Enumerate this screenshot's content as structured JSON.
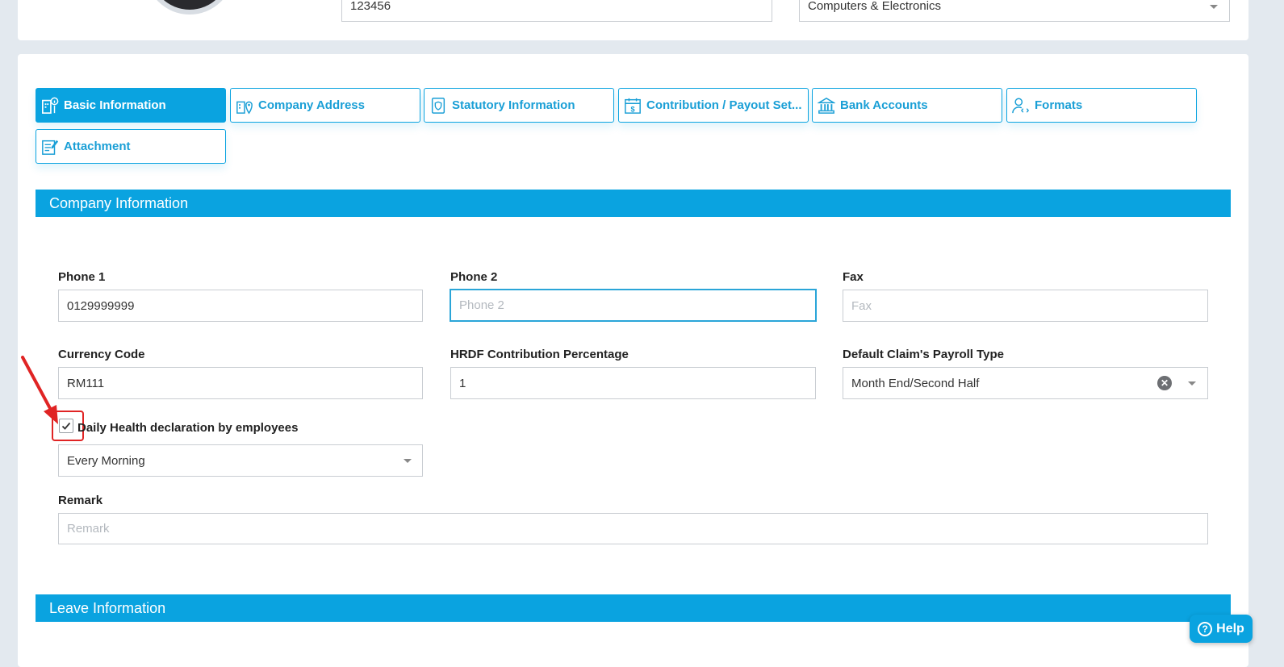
{
  "top": {
    "registration_value": "123456",
    "industry_value": "Computers & Electronics"
  },
  "tabs": [
    {
      "label": "Basic Information",
      "active": true,
      "icon": "building-info-icon"
    },
    {
      "label": "Company Address",
      "active": false,
      "icon": "building-pin-icon"
    },
    {
      "label": "Statutory Information",
      "active": false,
      "icon": "document-shield-icon"
    },
    {
      "label": "Contribution / Payout Set...",
      "active": false,
      "icon": "calendar-dollar-icon"
    },
    {
      "label": "Bank Accounts",
      "active": false,
      "icon": "bank-icon"
    },
    {
      "label": "Formats",
      "active": false,
      "icon": "user-code-icon"
    },
    {
      "label": "Attachment",
      "active": false,
      "icon": "document-pen-icon"
    }
  ],
  "company_info": {
    "title": "Company Information",
    "phone1": {
      "label": "Phone 1",
      "value": "0129999999"
    },
    "phone2": {
      "label": "Phone 2",
      "placeholder": "Phone 2"
    },
    "fax": {
      "label": "Fax",
      "placeholder": "Fax"
    },
    "currency": {
      "label": "Currency Code",
      "value": "RM111"
    },
    "hrdf": {
      "label": "HRDF Contribution Percentage",
      "value": "1"
    },
    "claim_type": {
      "label": "Default Claim's Payroll Type",
      "value": "Month End/Second Half"
    },
    "health": {
      "label": "Daily Health declaration by employees",
      "checked": true,
      "value": "Every Morning"
    },
    "remark": {
      "label": "Remark",
      "placeholder": "Remark"
    }
  },
  "leave_info": {
    "title": "Leave Information"
  },
  "help": {
    "label": "Help"
  },
  "colors": {
    "accent": "#0aa3e0",
    "highlight": "#e02424"
  }
}
